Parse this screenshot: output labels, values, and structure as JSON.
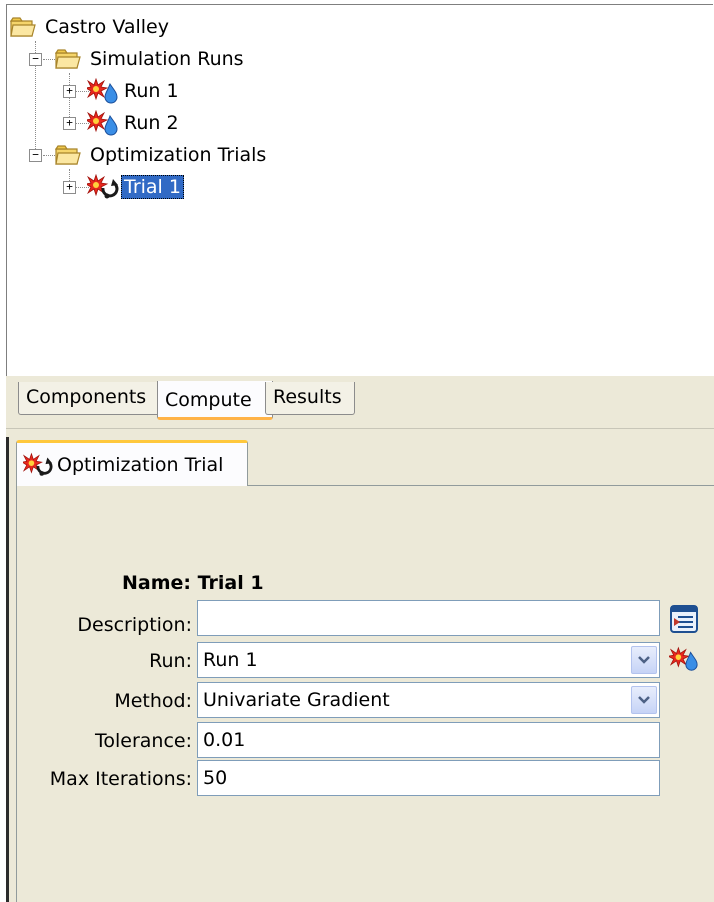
{
  "tree": {
    "root": {
      "label": "Castro Valley",
      "icon": "folder-icon"
    },
    "groups": [
      {
        "label": "Simulation Runs",
        "icon": "folder-icon",
        "items": [
          {
            "label": "Run 1",
            "icon": "simulation-run-icon"
          },
          {
            "label": "Run 2",
            "icon": "simulation-run-icon"
          }
        ]
      },
      {
        "label": "Optimization Trials",
        "icon": "folder-icon",
        "items": [
          {
            "label": "Trial 1",
            "icon": "optimization-trial-icon",
            "selected": true
          }
        ]
      }
    ]
  },
  "tabs": [
    {
      "label": "Components",
      "active": false
    },
    {
      "label": "Compute",
      "active": true
    },
    {
      "label": "Results",
      "active": false
    }
  ],
  "editor": {
    "tab_label": "Optimization Trial",
    "name_text": "Name: Trial 1",
    "fields": {
      "description": {
        "label": "Description:",
        "value": ""
      },
      "run": {
        "label": "Run:",
        "value": "Run 1"
      },
      "method": {
        "label": "Method:",
        "value": "Univariate Gradient"
      },
      "tolerance": {
        "label": "Tolerance:",
        "value": "0.01"
      },
      "max_iterations": {
        "label": "Max Iterations:",
        "value": "50"
      }
    }
  },
  "colors": {
    "selection": "#316ac5",
    "panel_bg": "#ece9d8",
    "tab_accent": "#ffc83c"
  }
}
